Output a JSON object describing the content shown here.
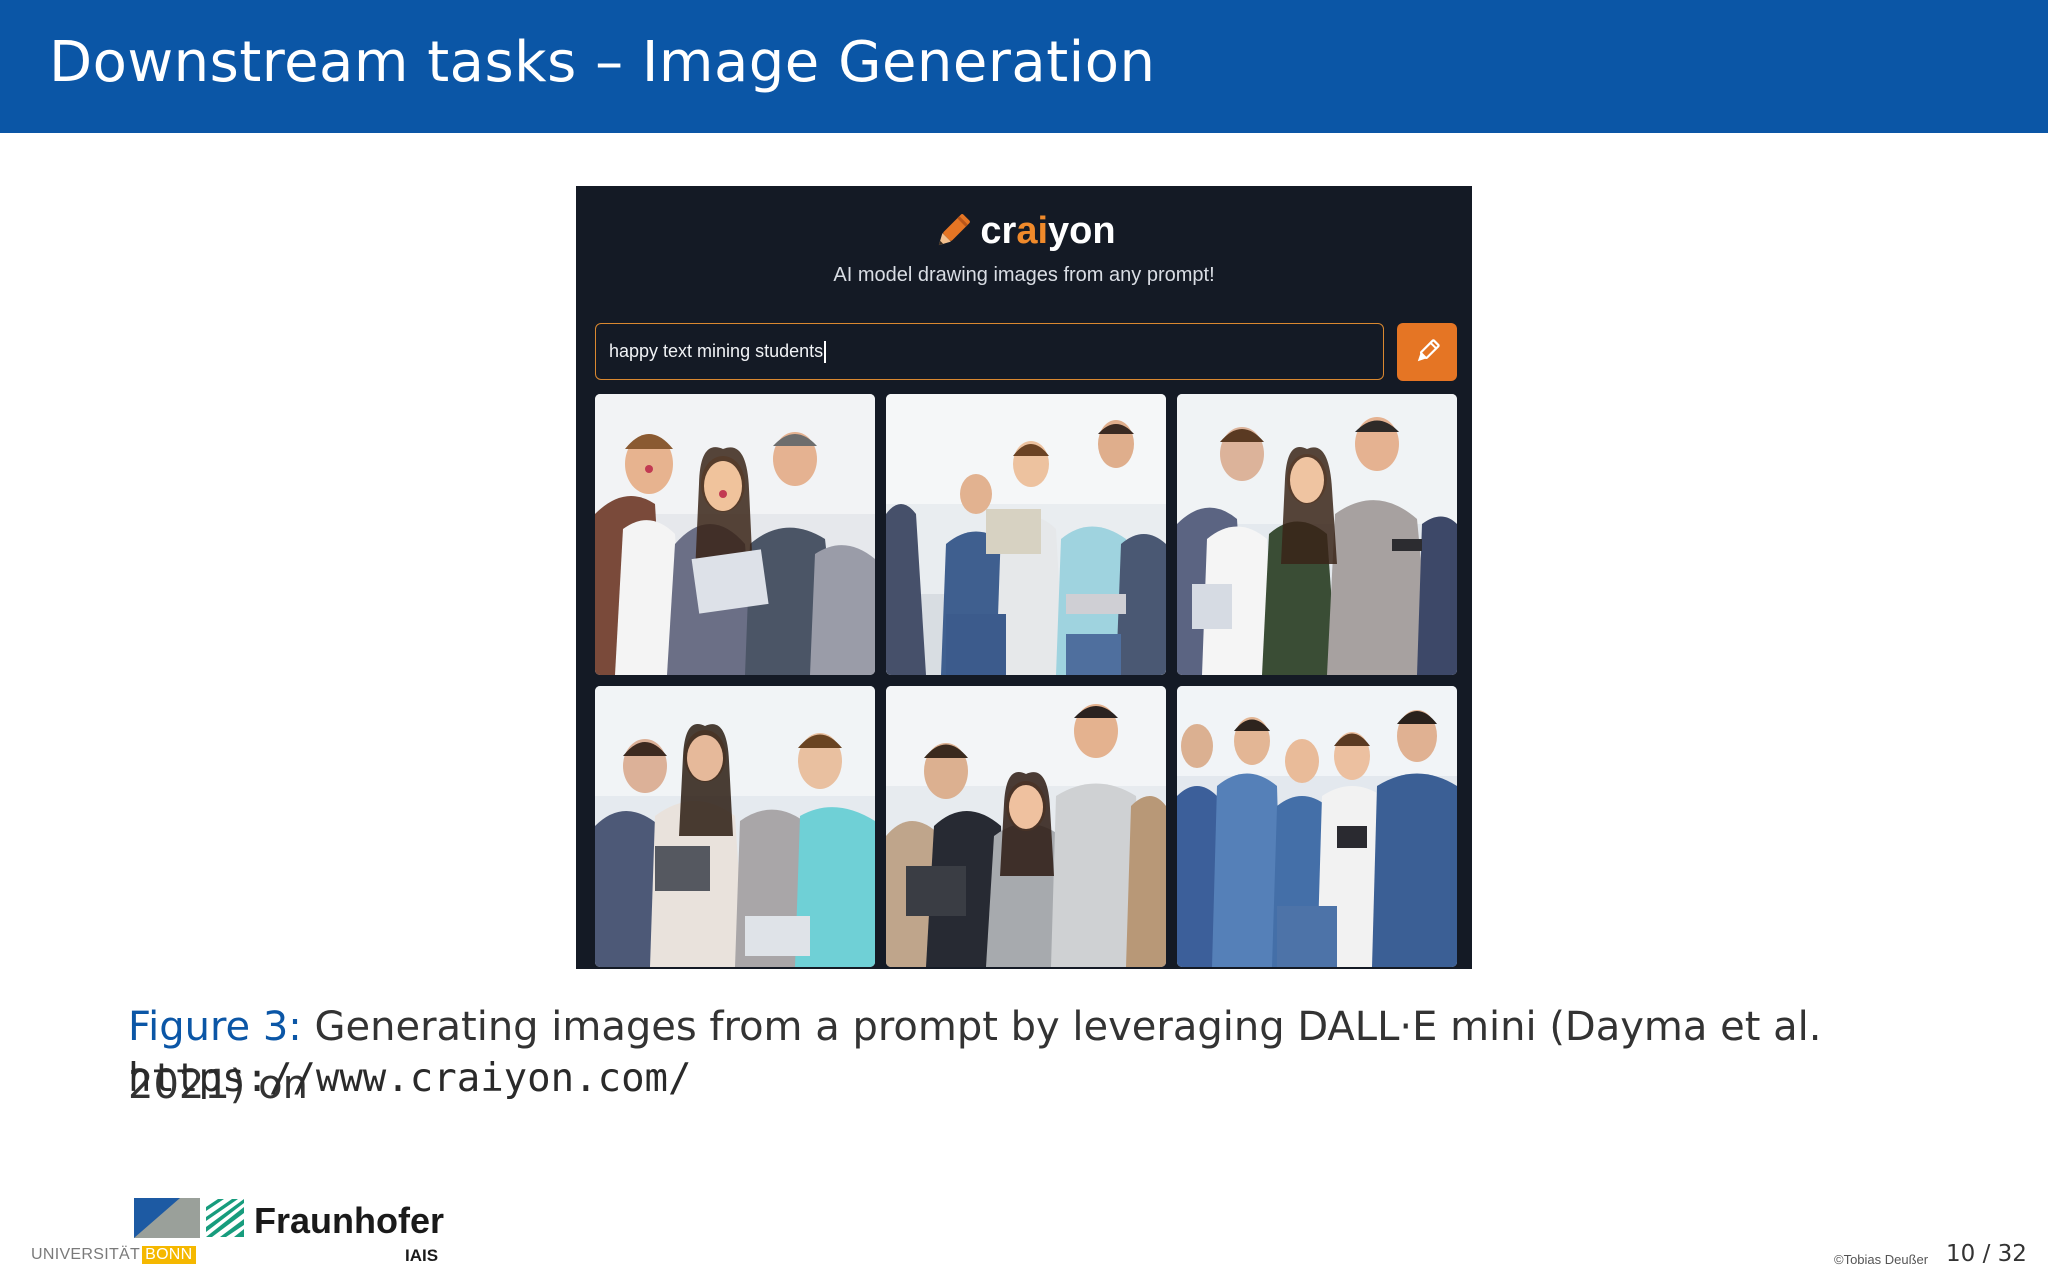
{
  "slide": {
    "title": "Downstream tasks – Image Generation"
  },
  "craiyon": {
    "logo_part1": "cr",
    "logo_accent": "ai",
    "logo_part2": "yon",
    "tagline": "AI model drawing images from any prompt!",
    "prompt_value": "happy text mining students",
    "draw_button_icon": "pencil-icon",
    "accent_color": "#e57524",
    "background_color": "#141a25",
    "image_count": 6
  },
  "caption": {
    "label": "Figure 3:",
    "text": "Generating images from a prompt by leveraging DALL·E mini (Dayma et al. 2021) on",
    "url": "https://www.craiyon.com/"
  },
  "footer": {
    "university": "UNIVERSITÄT",
    "university_city": "BONN",
    "institute": "Fraunhofer",
    "institute_sub": "IAIS",
    "copyright": "©Tobias Deußer",
    "page": "10 / 32"
  },
  "colors": {
    "header": "#0b56a6",
    "caption_label": "#0b56a6",
    "bonn_yellow": "#f5b800",
    "fraunhofer_green": "#179c7d"
  }
}
